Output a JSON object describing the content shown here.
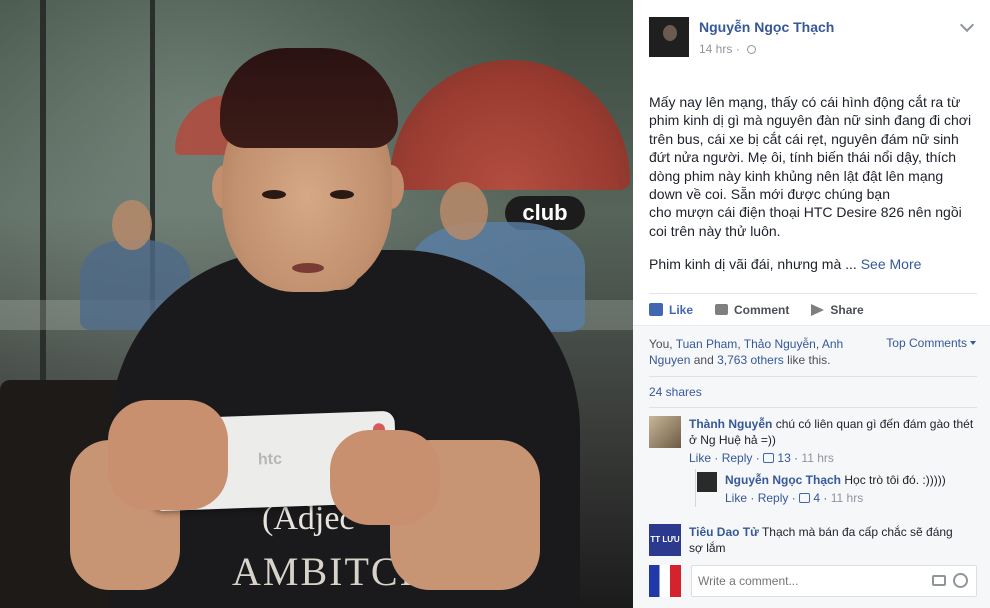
{
  "photo": {
    "sign_text": "club",
    "phone_brand": "htc",
    "tee_line1": "(Adjec",
    "tee_line2": "AMBITCI"
  },
  "post": {
    "author": "Nguyễn Ngọc Thạch",
    "time": "14 hrs",
    "text": "Mấy nay lên mạng, thấy có cái hình động cắt ra từ phim kinh dị gì mà nguyên đàn nữ sinh đang đi chơi trên bus, cái xe bị cắt cái rẹt, nguyên đám nữ sinh đứt nửa người. Mẹ ôi, tính biến thái nổi dậy, thích dòng phim này kinh khủng nên lật đật lên mạng down về coi. Sẵn mới được chúng bạn\ncho mượn cái điện thoại HTC Desire 826 nên ngồi coi trên này thử luôn.",
    "text2": "Phim kinh dị vãi đái, nhưng mà ...",
    "see_more": "See More"
  },
  "actions": {
    "like": "Like",
    "comment": "Comment",
    "share": "Share"
  },
  "feedback": {
    "likes_prefix": "You,",
    "liker1": "Tuan Pham",
    "liker2": "Thảo Nguyễn",
    "liker3": "Anh Nguyen",
    "and": "and",
    "others": "3,763 others",
    "like_this": "like this.",
    "top_comments": "Top Comments",
    "shares": "24 shares"
  },
  "comments": [
    {
      "name": "Thành Nguyễn",
      "text": "chú có liên quan gì đến đám gào thét ở Ng Huệ hả =))",
      "like": "Like",
      "reply": "Reply",
      "likes_count": "13",
      "time": "11 hrs"
    },
    {
      "name": "Nguyễn Ngọc Thạch",
      "text": "Học trò tôi đó. :)))))",
      "like": "Like",
      "reply": "Reply",
      "likes_count": "4",
      "time": "11 hrs"
    },
    {
      "name": "Tiêu Dao Tử",
      "text": "Thạch mà bán đa cấp chắc sẽ đáng sợ lắm",
      "avatar_text": "TT LƯU"
    }
  ],
  "composer": {
    "placeholder": "Write a comment..."
  },
  "colors": {
    "link": "#365899",
    "brand": "#4267b2",
    "feedback_bg": "#f6f7f9"
  }
}
